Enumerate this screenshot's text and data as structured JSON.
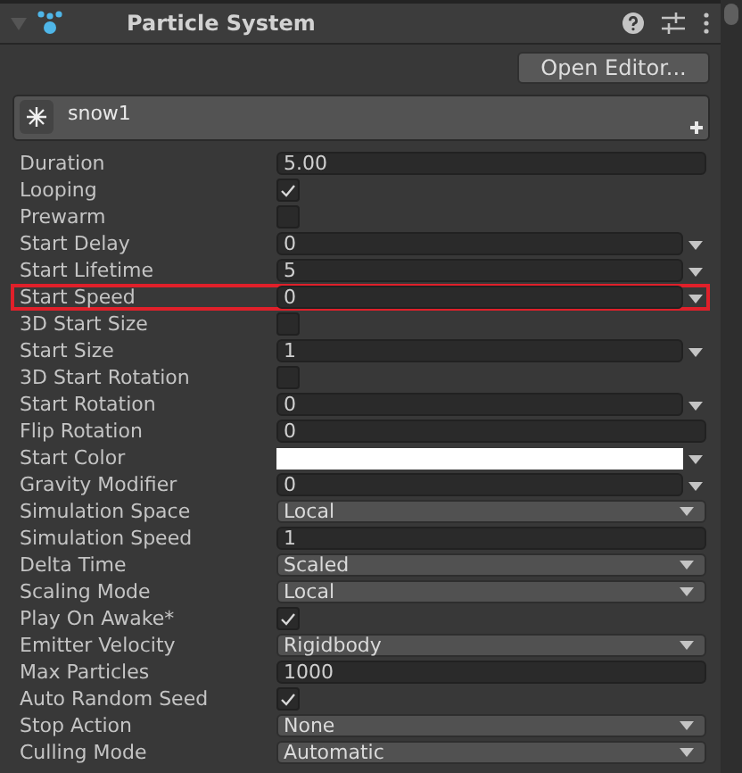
{
  "component": {
    "title": "Particle System",
    "expanded": true
  },
  "open_editor": "Open Editor...",
  "system": {
    "name": "snow1"
  },
  "properties": [
    {
      "label": "Duration",
      "kind": "field",
      "value": "5.00",
      "highlighted": false
    },
    {
      "label": "Looping",
      "kind": "check",
      "checked": true,
      "highlighted": false
    },
    {
      "label": "Prewarm",
      "kind": "check",
      "checked": false,
      "highlighted": false
    },
    {
      "label": "Start Delay",
      "kind": "curve",
      "value": "0",
      "highlighted": false
    },
    {
      "label": "Start Lifetime",
      "kind": "curve",
      "value": "5",
      "highlighted": false
    },
    {
      "label": "Start Speed",
      "kind": "curve",
      "value": "0",
      "highlighted": true
    },
    {
      "label": "3D Start Size",
      "kind": "check",
      "checked": false,
      "highlighted": false
    },
    {
      "label": "Start Size",
      "kind": "curve",
      "value": "1",
      "highlighted": false
    },
    {
      "label": "3D Start Rotation",
      "kind": "check",
      "checked": false,
      "highlighted": false
    },
    {
      "label": "Start Rotation",
      "kind": "curve",
      "value": "0",
      "highlighted": false
    },
    {
      "label": "Flip Rotation",
      "kind": "field",
      "value": "0",
      "highlighted": false
    },
    {
      "label": "Start Color",
      "kind": "color",
      "color": "#ffffff",
      "highlighted": false
    },
    {
      "label": "Gravity Modifier",
      "kind": "curve",
      "value": "0",
      "highlighted": false
    },
    {
      "label": "Simulation Space",
      "kind": "dropdown",
      "value": "Local",
      "highlighted": false
    },
    {
      "label": "Simulation Speed",
      "kind": "field",
      "value": "1",
      "highlighted": false
    },
    {
      "label": "Delta Time",
      "kind": "dropdown",
      "value": "Scaled",
      "highlighted": false
    },
    {
      "label": "Scaling Mode",
      "kind": "dropdown",
      "value": "Local",
      "highlighted": false
    },
    {
      "label": "Play On Awake*",
      "kind": "check",
      "checked": true,
      "highlighted": false
    },
    {
      "label": "Emitter Velocity",
      "kind": "dropdown",
      "value": "Rigidbody",
      "highlighted": false
    },
    {
      "label": "Max Particles",
      "kind": "field",
      "value": "1000",
      "highlighted": false
    },
    {
      "label": "Auto Random Seed",
      "kind": "check",
      "checked": true,
      "highlighted": false
    },
    {
      "label": "Stop Action",
      "kind": "dropdown",
      "value": "None",
      "highlighted": false
    },
    {
      "label": "Culling Mode",
      "kind": "dropdown",
      "value": "Automatic",
      "highlighted": false
    }
  ]
}
